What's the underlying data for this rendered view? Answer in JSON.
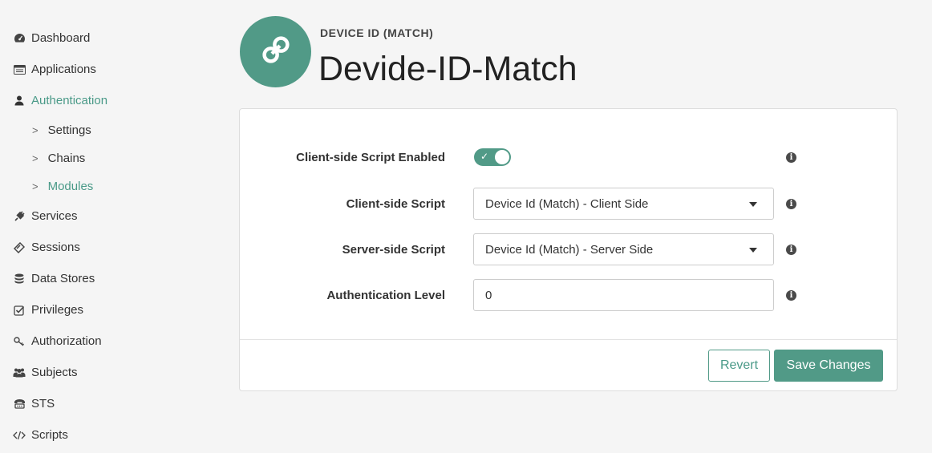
{
  "sidebar": {
    "items": [
      {
        "label": "Dashboard",
        "icon": "dashboard-icon"
      },
      {
        "label": "Applications",
        "icon": "applications-icon"
      },
      {
        "label": "Authentication",
        "icon": "user-icon"
      },
      {
        "label": "Services",
        "icon": "plug-icon"
      },
      {
        "label": "Sessions",
        "icon": "ticket-icon"
      },
      {
        "label": "Data Stores",
        "icon": "database-icon"
      },
      {
        "label": "Privileges",
        "icon": "check-square-icon"
      },
      {
        "label": "Authorization",
        "icon": "key-icon"
      },
      {
        "label": "Subjects",
        "icon": "users-icon"
      },
      {
        "label": "STS",
        "icon": "sts-icon"
      },
      {
        "label": "Scripts",
        "icon": "code-icon"
      }
    ],
    "sub_items": [
      {
        "label": "Settings"
      },
      {
        "label": "Chains"
      },
      {
        "label": "Modules"
      }
    ],
    "sub_chevron": ">"
  },
  "header": {
    "type_label": "DEVICE ID (MATCH)",
    "title": "Devide-ID-Match",
    "icon": "link-icon"
  },
  "form": {
    "client_script_enabled": {
      "label": "Client-side Script Enabled",
      "value": true
    },
    "client_script": {
      "label": "Client-side Script",
      "value": "Device Id (Match) - Client Side"
    },
    "server_script": {
      "label": "Server-side Script",
      "value": "Device Id (Match) - Server Side"
    },
    "auth_level": {
      "label": "Authentication Level",
      "value": "0"
    },
    "info_glyph": "i",
    "check_glyph": "✓"
  },
  "actions": {
    "revert_label": "Revert",
    "save_label": "Save Changes"
  },
  "colors": {
    "accent": "#519a87",
    "active_text": "#4a9a88"
  }
}
